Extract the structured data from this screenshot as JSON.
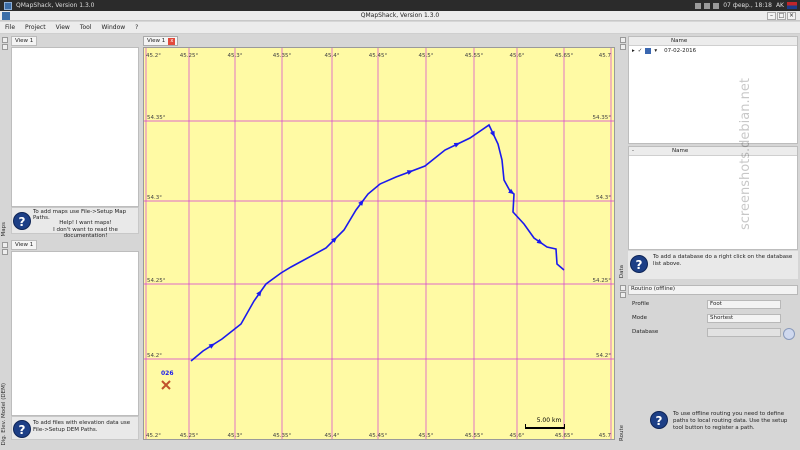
{
  "taskbar": {
    "app_title": "QMapShack, Version 1.3.0",
    "clock": "07 февр., 18:18",
    "layout": "AK"
  },
  "window": {
    "title": "QMapShack, Version 1.3.0"
  },
  "menu": [
    "File",
    "Project",
    "View",
    "Tool",
    "Window",
    "?"
  ],
  "left": {
    "maps_tab": "View 1",
    "maps_help_line": "To add maps use File->Setup Map Paths.",
    "maps_help_link1": "Help! I want maps!",
    "maps_help_link2": "I don't want to read the documentation!",
    "maps_side": "Maps",
    "dem_tab": "View 1",
    "dem_help": "To add files with elevation data use File->Setup DEM Paths.",
    "dem_side": "Dig. Elev. Model (DEM)"
  },
  "map": {
    "tab_label": "View 1",
    "tab_close": "x",
    "lon_labels": [
      "45.2°",
      "45.25°",
      "45.3°",
      "45.35°",
      "45.4°",
      "45.45°",
      "45.5°",
      "45.55°",
      "45.6°",
      "45.65°",
      "45.7"
    ],
    "lat_labels": [
      "54.35°",
      "54.3°",
      "54.25°",
      "54.2°"
    ],
    "waypoint_label": "026",
    "scale_label": "5.00 km"
  },
  "right": {
    "workspace_header": "Name",
    "project_name": "07-02-2016",
    "db_col1": "-",
    "db_header": "Name",
    "db_help": "To add a database do a right click on the database list above.",
    "data_side": "Data",
    "routing_title": "Routino (offline)",
    "profile_label": "Profile",
    "profile_value": "Foot",
    "mode_label": "Mode",
    "mode_value": "Shortest",
    "database_label": "Database",
    "route_help": "To use offline routing you need to define paths to local routing data. Use the setup tool button to register a path.",
    "route_side": "Route"
  },
  "watermark": "screenshots.debian.net",
  "colors": {
    "map_bg": "#fffaa4",
    "grid": "#d43bd4",
    "track": "#1a1aee",
    "waypoint": "#c0532b"
  }
}
